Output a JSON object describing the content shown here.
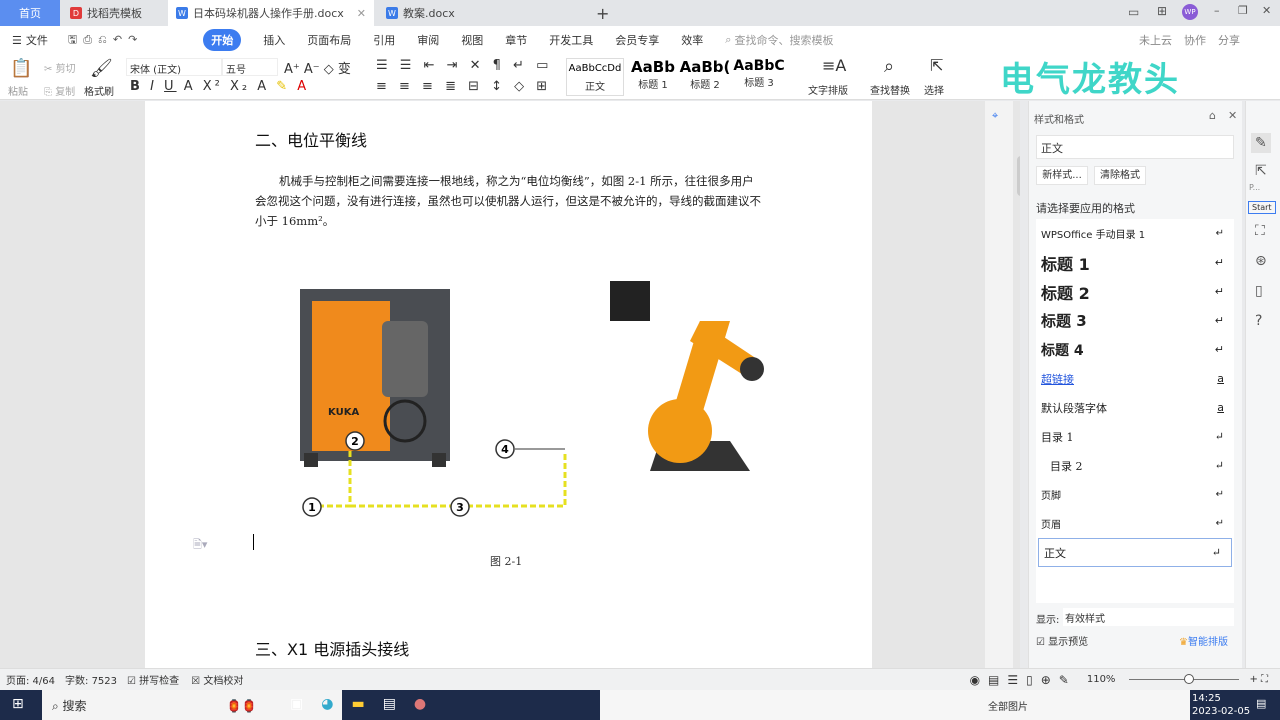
{
  "tabs": {
    "home": "首页",
    "template": "找稻壳模板",
    "active": "日本码垛机器人操作手册.docx",
    "other": "教案.docx",
    "new": "+"
  },
  "window": {
    "avatar": "WP"
  },
  "menu": {
    "file": "文件",
    "items": [
      "开始",
      "插入",
      "页面布局",
      "引用",
      "审阅",
      "视图",
      "章节",
      "开发工具",
      "会员专享",
      "效率"
    ],
    "search_placeholder": "查找命令、搜索模板",
    "cloud": "未上云",
    "collab": "协作",
    "share": "分享"
  },
  "ribbon": {
    "paste": "粘贴",
    "cut": "剪切",
    "copy": "复制",
    "format_painter": "格式刷",
    "font": "宋体 (正文)",
    "size": "五号",
    "styles": [
      {
        "preview": "AaBbCcDd",
        "name": "正文"
      },
      {
        "preview": "AaBb",
        "name": "标题 1"
      },
      {
        "preview": "AaBb(",
        "name": "标题 2"
      },
      {
        "preview": "AaBbC",
        "name": "标题 3"
      }
    ],
    "text_layout": "文字排版",
    "find_replace": "查找替换",
    "select": "选择"
  },
  "watermark": "电气龙教头",
  "document": {
    "heading1": "二、电位平衡线",
    "paragraph": "机械手与控制柜之间需要连接一根地线，称之为“电位均衡线”，如图 2-1 所示，往往很多用户会忽视这个问题，没有进行连接，虽然也可以使机器人运行，但这是不被允许的，导线的截面建议不小于 16mm²。",
    "figure_labels": [
      "1",
      "2",
      "3",
      "4"
    ],
    "cabinet_brand": "KUKA",
    "caption": "图 2-1",
    "heading2": "三、X1 电源插头接线"
  },
  "panel": {
    "title": "样式和格式",
    "current_style": "正文",
    "new_style": "新样式...",
    "clear_format": "清除格式",
    "prompt": "请选择要应用的格式",
    "styles": [
      "WPSOffice 手动目录 1",
      "标题 1",
      "标题 2",
      "标题 3",
      "标题 4",
      "超链接",
      "默认段落字体",
      "目录 1",
      "目录 2",
      "页脚",
      "页眉",
      "正文"
    ],
    "show_label": "显示:",
    "show_value": "有效样式",
    "preview_label": "显示预览",
    "smart_layout": "智能排版"
  },
  "sidebar": {
    "tooltip": "P...",
    "start": "Start"
  },
  "status": {
    "page": "页面: 4/64",
    "words": "字数: 7523",
    "spell": "拼写检查",
    "proof": "文档校对",
    "zoom": "110%"
  },
  "taskbar": {
    "search": "搜索",
    "all_images": "全部图片",
    "time": "14:25",
    "date": "2023-02-05"
  }
}
